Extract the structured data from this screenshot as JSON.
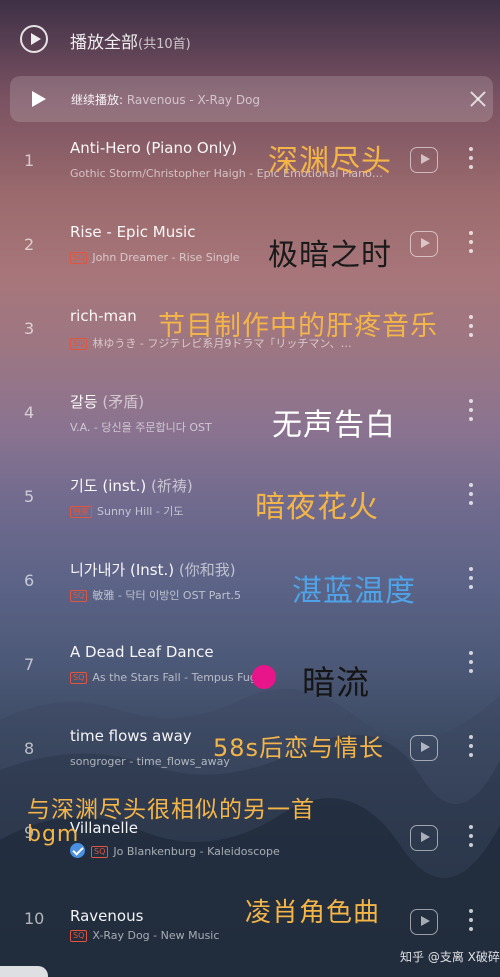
{
  "header": {
    "play_all_label": "播放全部",
    "play_all_count": "(共10首)"
  },
  "continue_bar": {
    "label": "继续播放: ",
    "track": "Ravenous - X-Ray Dog"
  },
  "songs": [
    {
      "index": "1",
      "title": "Anti-Hero (Piano Only)",
      "alt_title": "",
      "badge": "",
      "subtitle": "Gothic Storm/Christopher Haigh - Epic Emotional Piano…",
      "verified": false
    },
    {
      "index": "2",
      "title": "Rise - Epic Music",
      "alt_title": "",
      "badge": "SQ",
      "subtitle": "John Dreamer - Rise   Single",
      "verified": false
    },
    {
      "index": "3",
      "title": "rich-man",
      "alt_title": "",
      "badge": "SQ",
      "subtitle": "林ゆうき - フジテレビ系月9ドラマ「リッチマン、…",
      "verified": false
    },
    {
      "index": "4",
      "title": "갈등",
      "alt_title": " (矛盾)",
      "badge": "",
      "subtitle": "V.A. - 당신을 주문합니다 OST",
      "verified": false
    },
    {
      "index": "5",
      "title": "기도 (inst.)",
      "alt_title": " (祈祷)",
      "badge": "独家",
      "subtitle": "Sunny Hill - 기도",
      "verified": false
    },
    {
      "index": "6",
      "title": "니가내가 (Inst.)",
      "alt_title": " (你和我)",
      "badge": "SQ",
      "subtitle": "敏雅 - 닥터 이방인 OST Part.5",
      "verified": false
    },
    {
      "index": "7",
      "title": "A Dead Leaf Dance",
      "alt_title": "",
      "badge": "SQ",
      "subtitle": "As the Stars Fall - Tempus Fugit",
      "verified": false
    },
    {
      "index": "8",
      "title": "time flows away",
      "alt_title": "",
      "badge": "",
      "subtitle": "songroger - time_flows_away",
      "verified": false
    },
    {
      "index": "9",
      "title": "Villanelle",
      "alt_title": "",
      "badge": "SQ",
      "subtitle": "Jo Blankenburg - Kaleidoscope",
      "verified": true
    },
    {
      "index": "10",
      "title": "Ravenous",
      "alt_title": "",
      "badge": "SQ",
      "subtitle": "X-Ray Dog - New Music",
      "verified": false
    }
  ],
  "annotations": [
    {
      "text": "深渊尽头",
      "color": "#f4b548"
    },
    {
      "text": "极暗之时",
      "color": "#1a1a1a"
    },
    {
      "text": "节目制作中的肝疼音乐",
      "color": "#f4b548"
    },
    {
      "text": "无声告白",
      "color": "#ffffff"
    },
    {
      "text": "暗夜花火",
      "color": "#f4b548"
    },
    {
      "text": "湛蓝温度",
      "color": "#4fa3e8"
    },
    {
      "text": "暗流",
      "color": "#151515"
    },
    {
      "text": "58s后恋与情长",
      "color": "#f4b548"
    },
    {
      "text": "与深渊尽头很相似的另一首",
      "color": "#f4b548"
    },
    {
      "text": "bgm",
      "color": "#f4b548"
    },
    {
      "text": "凌肖角色曲",
      "color": "#f4b548"
    }
  ],
  "watermark": "知乎 @支离 X破碎"
}
